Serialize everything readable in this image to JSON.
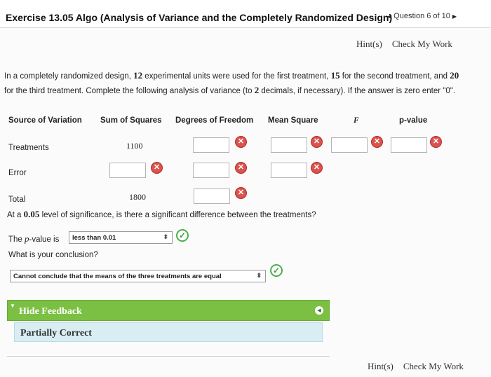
{
  "header": {
    "title": "Exercise 13.05 Algo (Analysis of Variance and the Completely Randomized Design)",
    "question_position": "Question 6 of 10"
  },
  "toolbar": {
    "hint_label": "Hint(s)",
    "check_label": "Check My Work"
  },
  "problem": {
    "part1": "In a completely randomized design, ",
    "n1": "12",
    "part2": " experimental units were used for the first treatment, ",
    "n2": "15",
    "part3": " for the second treatment, and ",
    "n3": "20",
    "part4": " for the third treatment. Complete the following analysis of variance (to ",
    "decimals": "2",
    "part5": " decimals, if necessary). If the answer is zero enter \"",
    "zero": "0",
    "part6": "\"."
  },
  "table": {
    "headers": {
      "source": "Source of Variation",
      "ss": "Sum of Squares",
      "df": "Degrees of Freedom",
      "ms": "Mean Square",
      "f": "F",
      "p": "p-value"
    },
    "rows": {
      "treatments": {
        "label": "Treatments",
        "ss": "1100"
      },
      "error": {
        "label": "Error"
      },
      "total": {
        "label": "Total",
        "ss": "1800"
      }
    }
  },
  "significance": {
    "pre": "At a ",
    "alpha": "0.05",
    "post": " level of significance, is there a significant difference between the treatments?",
    "pvalue_pre": "The ",
    "pvalue_var": "p",
    "pvalue_post": "-value is",
    "pvalue_selected": "less than 0.01",
    "conclusion_question": "What is your conclusion?",
    "conclusion_selected": "Cannot conclude that the means of the three treatments are equal"
  },
  "feedback": {
    "toggle_label": "Hide Feedback",
    "status": "Partially Correct"
  },
  "colors": {
    "incorrect": "#d9534f",
    "correct": "#4cae4c",
    "feedback_bar": "#7bc043",
    "feedback_body": "#d9eef2"
  }
}
